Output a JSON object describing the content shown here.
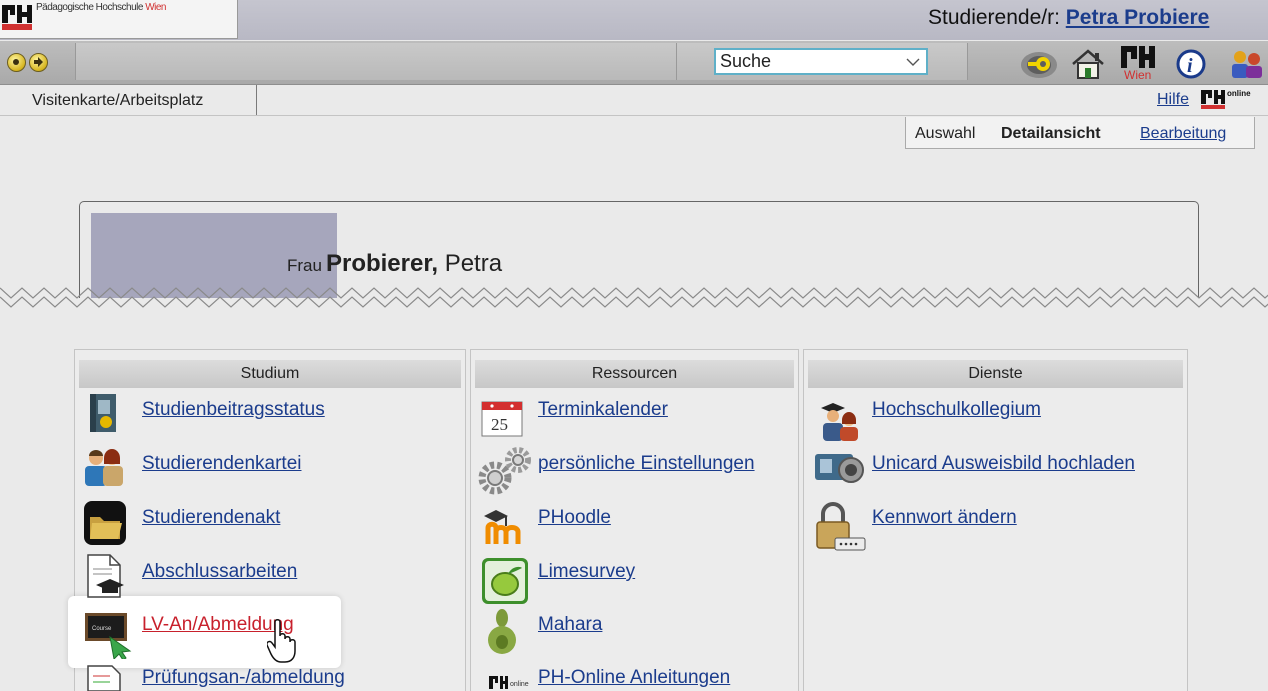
{
  "header": {
    "logo_text": "Pädagogische Hochschule",
    "logo_text_accent": "Wien",
    "user_label": "Studierende/r:",
    "user_name": "Petra Probiere"
  },
  "toolbar": {
    "search_value": "Suche",
    "icons": [
      "back-icon",
      "forward-icon",
      "key-icon",
      "home-icon",
      "ph-wien-logo-icon",
      "info-icon",
      "people-icon"
    ]
  },
  "tabs": {
    "active": "Visitenkarte/Arbeitsplatz",
    "help": "Hilfe"
  },
  "viewmode": {
    "auswahl": "Auswahl",
    "detail": "Detailansicht",
    "edit": "Bearbeitung"
  },
  "person": {
    "salutation": "Frau",
    "lastname": "Probierer",
    "firstname": "Petra"
  },
  "columns": {
    "studium": {
      "title": "Studium",
      "items": [
        "Studienbeitragsstatus",
        "Studierendenkartei",
        "Studierendenakt",
        "Abschlussarbeiten",
        "LV-An/Abmeldung",
        "Prüfungsan-/abmeldung"
      ]
    },
    "ressourcen": {
      "title": "Ressourcen",
      "items": [
        "Terminkalender",
        "persönliche Einstellungen",
        "PHoodle",
        "Limesurvey",
        "Mahara",
        "PH-Online Anleitungen"
      ]
    },
    "dienste": {
      "title": "Dienste",
      "items": [
        "Hochschulkollegium",
        "Unicard Ausweisbild hochladen",
        "Kennwort ändern"
      ]
    }
  },
  "colors": {
    "link": "#1b3c8c",
    "active_link": "#c8202c",
    "photo": "#a6a6bc"
  }
}
